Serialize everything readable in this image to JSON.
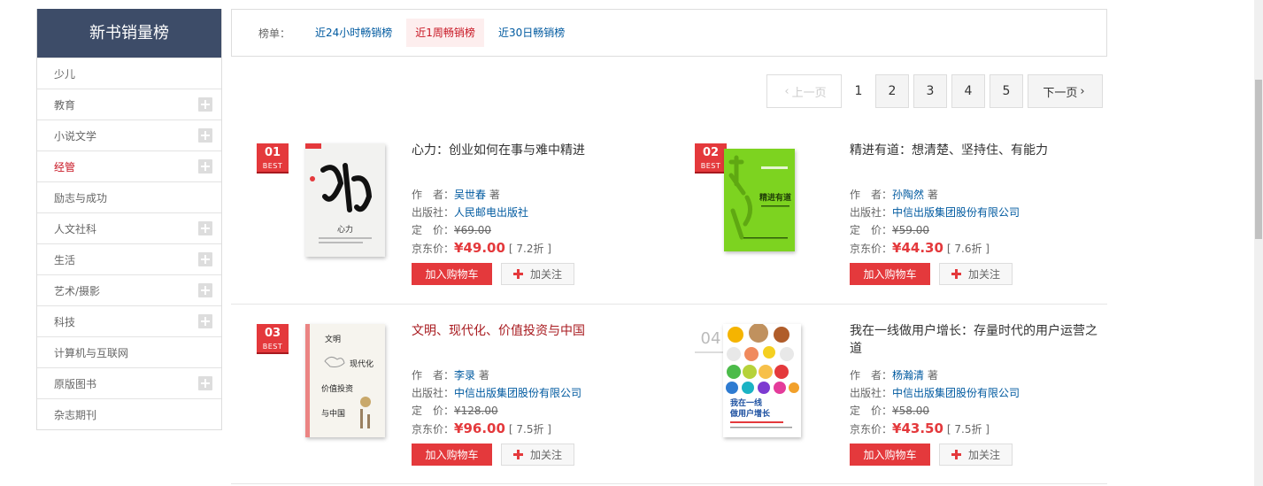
{
  "sidebar": {
    "title": "新书销量榜",
    "categories": [
      {
        "label": "少儿",
        "expandable": false,
        "active": false
      },
      {
        "label": "教育",
        "expandable": true,
        "active": false
      },
      {
        "label": "小说文学",
        "expandable": true,
        "active": false
      },
      {
        "label": "经管",
        "expandable": true,
        "active": true
      },
      {
        "label": "励志与成功",
        "expandable": false,
        "active": false
      },
      {
        "label": "人文社科",
        "expandable": true,
        "active": false
      },
      {
        "label": "生活",
        "expandable": true,
        "active": false
      },
      {
        "label": "艺术/摄影",
        "expandable": true,
        "active": false
      },
      {
        "label": "科技",
        "expandable": true,
        "active": false
      },
      {
        "label": "计算机与互联网",
        "expandable": false,
        "active": false
      },
      {
        "label": "原版图书",
        "expandable": true,
        "active": false
      },
      {
        "label": "杂志期刊",
        "expandable": false,
        "active": false
      }
    ]
  },
  "tabs": {
    "label": "榜单：",
    "items": [
      "近24小时畅销榜",
      "近1周畅销榜",
      "近30日畅销榜"
    ],
    "active_index": 1
  },
  "pager": {
    "prev": "上一页",
    "next": "下一页",
    "pages": [
      "1",
      "2",
      "3",
      "4",
      "5"
    ],
    "current": "1"
  },
  "labels": {
    "author": "作　者：",
    "publisher": "出版社：",
    "list_price": "定　价：",
    "jd_price": "京东价：",
    "author_suffix": "著",
    "add_cart": "加入购物车",
    "follow": "加关注",
    "best": "BEST"
  },
  "books": [
    {
      "rank": "01",
      "title": "心力：创业如何在事与难中精进",
      "author": "吴世春",
      "publisher": "人民邮电出版社",
      "list_price": "¥69.00",
      "price": "¥49.00",
      "discount": "[ 7.2折 ]",
      "highlight": false
    },
    {
      "rank": "02",
      "title": "精进有道：想清楚、坚持住、有能力",
      "author": "孙陶然",
      "publisher": "中信出版集团股份有限公司",
      "list_price": "¥59.00",
      "price": "¥44.30",
      "discount": "[ 7.6折 ]",
      "highlight": false
    },
    {
      "rank": "03",
      "title": "文明、现代化、价值投资与中国",
      "author": "李录",
      "publisher": "中信出版集团股份有限公司",
      "list_price": "¥128.00",
      "price": "¥96.00",
      "discount": "[ 7.5折 ]",
      "highlight": true
    },
    {
      "rank": "04",
      "title": "我在一线做用户增长：存量时代的用户运营之道",
      "author": "杨瀚清",
      "publisher": "中信出版集团股份有限公司",
      "list_price": "¥58.00",
      "price": "¥43.50",
      "discount": "[ 7.5折 ]",
      "highlight": false
    }
  ],
  "covers": {
    "book1_text": "心力",
    "book2_text": "精进有道",
    "book3_lines": [
      "文明",
      "现代化",
      "价值投资",
      "与中国"
    ],
    "book4_lines": [
      "我在一线",
      "做用户增长"
    ]
  },
  "colors": {
    "sidebar_header": "#3d4c68",
    "accent_red": "#e4393c",
    "link_blue": "#005aa0",
    "book2_green": "#7dd320"
  }
}
